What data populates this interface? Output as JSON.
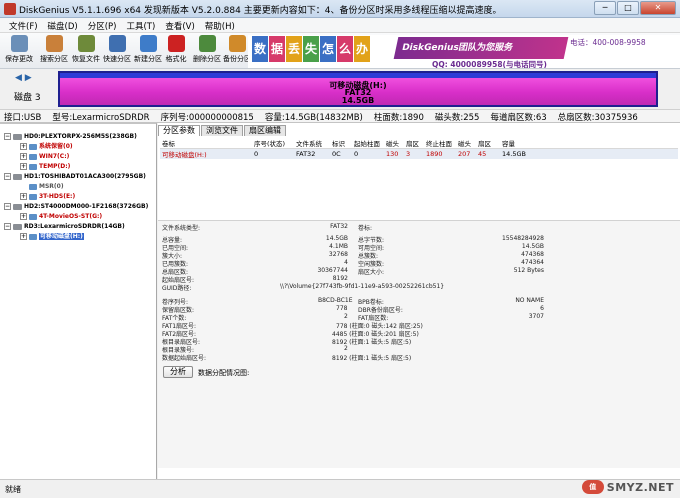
{
  "window": {
    "title": "DiskGenius V5.1.1.696 x64   发现新版本 V5.2.0.884 主要更新内容如下：4、备份分区时采用多线程压缩以提高速度。",
    "min": "─",
    "max": "□",
    "close": "✕"
  },
  "menu": [
    "文件(F)",
    "磁盘(D)",
    "分区(P)",
    "工具(T)",
    "查看(V)",
    "帮助(H)"
  ],
  "toolbar": [
    {
      "label": "保存更改",
      "color": "#6b8fb8"
    },
    {
      "label": "搜索分区",
      "color": "#c9803a"
    },
    {
      "label": "恢复文件",
      "color": "#6e8a3a"
    },
    {
      "label": "快速分区",
      "color": "#3f6fb0"
    },
    {
      "label": "新建分区",
      "color": "#3e7cc9"
    },
    {
      "label": "格式化",
      "color": "#cc2222"
    },
    {
      "label": "删除分区",
      "color": "#4d8a3d"
    },
    {
      "label": "备份分区",
      "color": "#d08a2a"
    }
  ],
  "banner": {
    "tiles": [
      "数",
      "据",
      "丢",
      "失",
      "怎",
      "么",
      "办"
    ],
    "slogan": "DiskGenius团队为您服务",
    "phone": "电话：400-008-9958",
    "qq": "QQ: 4000089958(与电话同号)"
  },
  "disk": {
    "label": "磁盘 3",
    "part_name": "可移动磁盘(H:)",
    "part_fs": "FAT32",
    "part_size": "14.5GB",
    "nav_left": "◀",
    "nav_right": "▶"
  },
  "diskinfo": [
    "接口:USB",
    "型号:LexarmicroSDRDR",
    "序列号:000000000815",
    "容量:14.5GB(14832MB)",
    "柱面数:1890",
    "磁头数:255",
    "每道扇区数:63",
    "总扇区数:30375936"
  ],
  "tree": [
    {
      "text": "HD0:PLEXTORPX-256M5S(238GB)",
      "kind": "disk"
    },
    {
      "text": "系统保留(0)",
      "kind": "part"
    },
    {
      "text": "WIN7(C:)",
      "kind": "part"
    },
    {
      "text": "TEMP(D:)",
      "kind": "part"
    },
    {
      "text": "HD1:TOSHIBADT01ACA300(2795GB)",
      "kind": "disk"
    },
    {
      "text": "MSR(0)",
      "kind": "plain"
    },
    {
      "text": "3T-HDS(E:)",
      "kind": "part"
    },
    {
      "text": "HD2:ST4000DM000-1F2168(3726GB)",
      "kind": "disk"
    },
    {
      "text": "4T-MovieOS-ST(G:)",
      "kind": "part"
    },
    {
      "text": "RD3:LexarmicroSDRDR(14GB)",
      "kind": "disk"
    },
    {
      "text": "可移动磁盘(H:)",
      "kind": "sel"
    }
  ],
  "tabs": [
    "分区参数",
    "浏览文件",
    "扇区编辑"
  ],
  "ptable": {
    "headers": [
      "卷标",
      "序号(状态)",
      "文件系统",
      "标识",
      "起始柱面",
      "磁头",
      "扇区",
      "终止柱面",
      "磁头",
      "扇区",
      "容量"
    ],
    "row": [
      "可移动磁盘(H:)",
      "0",
      "FAT32",
      "0C",
      "0",
      "130",
      "3",
      "1890",
      "207",
      "45",
      "14.5GB"
    ]
  },
  "fs": {
    "left": [
      [
        "文件系统类型:",
        "FAT32"
      ],
      [
        "总容量:",
        "14.5GB"
      ],
      [
        "已用空间:",
        "4.1MB"
      ],
      [
        "簇大小:",
        "32768"
      ],
      [
        "已用簇数:",
        "4"
      ],
      [
        "总扇区数:",
        "30367744"
      ],
      [
        "起始扇区号:",
        "8192"
      ],
      [
        "GUID路径:",
        "\\\\?\\Volume{27f743fb-9fd1-11e9-a593-00252261cb51}"
      ]
    ],
    "right": [
      [
        "卷标:",
        ""
      ],
      [
        "总字节数:",
        "15548284928"
      ],
      [
        "可用空间:",
        "14.5GB"
      ],
      [
        "总簇数:",
        "474368"
      ],
      [
        "空闲簇数:",
        "474364"
      ],
      [
        "扇区大小:",
        "512 Bytes"
      ]
    ],
    "left2": [
      [
        "卷序列号:",
        "B8CD-BC1E"
      ],
      [
        "保留扇区数:",
        "778"
      ],
      [
        "FAT个数:",
        "2"
      ],
      [
        "FAT1扇区号:",
        "778 (柱面:0 磁头:142 扇区:25)"
      ],
      [
        "FAT2扇区号:",
        "4485 (柱面:0 磁头:201 扇区:5)"
      ],
      [
        "根目录扇区号:",
        "8192 (柱面:1 磁头:5 扇区:5)"
      ],
      [
        "根目录簇号:",
        "2"
      ],
      [
        "数据起始扇区号:",
        "8192 (柱面:1 磁头:5 扇区:5)"
      ]
    ],
    "right2": [
      [
        "BPB卷标:",
        "NO NAME"
      ],
      [
        "DBR备份扇区号:",
        "6"
      ],
      [
        "FAT扇区数:",
        "3707"
      ]
    ]
  },
  "analyze": {
    "button": "分析",
    "note": "数据分配情况图:"
  },
  "status": "就绪",
  "watermark": {
    "logo": "值",
    "text": "SMYZ.NET"
  }
}
